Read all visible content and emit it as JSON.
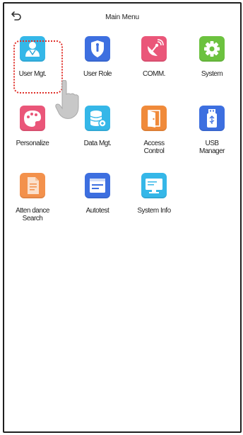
{
  "header": {
    "title": "Main Menu",
    "back_icon": "back-arrow-icon"
  },
  "menu": {
    "items": [
      {
        "label": "User Mgt.",
        "icon": "user-icon",
        "color": "#35b7e8"
      },
      {
        "label": "User Role",
        "icon": "shield-icon",
        "color": "#3d6fe0"
      },
      {
        "label": "COMM.",
        "icon": "satellite-dish-icon",
        "color": "#ea5679"
      },
      {
        "label": "System",
        "icon": "gear-icon",
        "color": "#6cc23f"
      },
      {
        "label": "Personalize",
        "icon": "palette-icon",
        "color": "#ea5679"
      },
      {
        "label": "Data Mgt.",
        "icon": "database-icon",
        "color": "#35b7e8"
      },
      {
        "label": "Access\nControl",
        "icon": "door-icon",
        "color": "#f08a3a"
      },
      {
        "label": "USB\nManager",
        "icon": "usb-drive-icon",
        "color": "#3d6fe0"
      },
      {
        "label": "Atten dance\nSearch",
        "icon": "document-search-icon",
        "color": "#f3914c"
      },
      {
        "label": "Autotest",
        "icon": "autotest-screen-icon",
        "color": "#3d6fe0"
      },
      {
        "label": "System Info",
        "icon": "monitor-icon",
        "color": "#35b7e8"
      }
    ],
    "selected_index": 0,
    "selection_color": "#e0302a",
    "pointer_icon": "hand-pointer-icon"
  }
}
